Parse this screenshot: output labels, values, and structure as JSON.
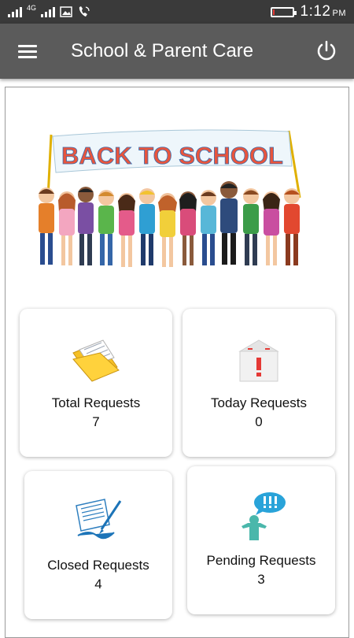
{
  "status_bar": {
    "network": "4G",
    "time": "1:12",
    "ampm": "PM",
    "battery_level": 0.08,
    "battery_color": "#e53935"
  },
  "app_bar": {
    "title": "School & Parent Care",
    "menu_icon": "hamburger-menu-icon",
    "power_icon": "power-icon"
  },
  "banner": {
    "text": "BACK TO SCHOOL"
  },
  "cards": {
    "total": {
      "label": "Total Requests",
      "count": "7",
      "icon": "folder-documents-icon"
    },
    "today": {
      "label": "Today Requests",
      "count": "0",
      "icon": "inbox-alert-icon"
    },
    "closed": {
      "label": "Closed Requests",
      "count": "4",
      "icon": "signed-document-icon"
    },
    "pending": {
      "label": "Pending Requests",
      "count": "3",
      "icon": "confused-person-icon"
    }
  },
  "colors": {
    "app_bar": "#5b5b5b",
    "status_bar": "#3a3a3a",
    "accent_blue": "#29a3d9"
  }
}
